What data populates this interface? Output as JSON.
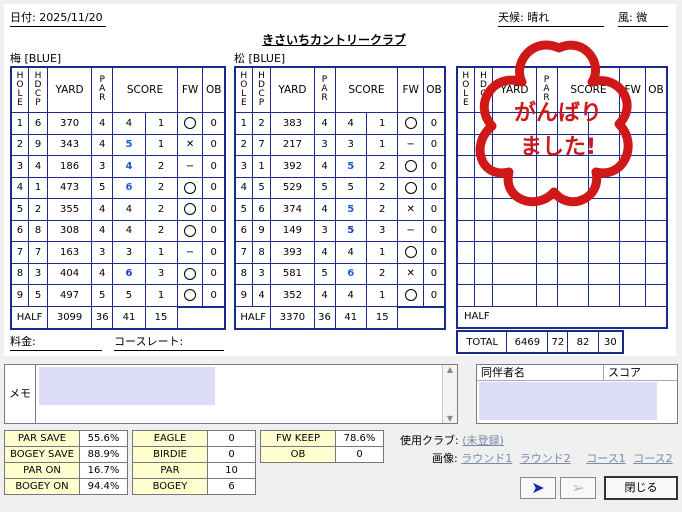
{
  "header": {
    "date_label": "日付: 2025/11/20",
    "title": "きさいちカントリークラブ",
    "weather_label": "天候: 晴れ",
    "wind_label": "風: 微"
  },
  "front": {
    "heading": "梅 [BLUE]"
  },
  "back": {
    "heading": "松 [BLUE]"
  },
  "columns": {
    "hole": "HOLE",
    "hdcp": "HDCP",
    "yard": "YARD",
    "par": "PAR",
    "score": "SCORE",
    "fw": "FW",
    "ob": "OB"
  },
  "front_rows": [
    {
      "hole": "1",
      "hdcp": "6",
      "yard": "370",
      "par": "4",
      "s": "4",
      "p": "1",
      "fw": "o",
      "ob": "0"
    },
    {
      "hole": "2",
      "hdcp": "9",
      "yard": "343",
      "par": "4",
      "s": "5",
      "p": "1",
      "fw": "x",
      "ob": "0"
    },
    {
      "hole": "3",
      "hdcp": "4",
      "yard": "186",
      "par": "3",
      "s": "4",
      "p": "2",
      "fw": "-",
      "ob": "0"
    },
    {
      "hole": "4",
      "hdcp": "1",
      "yard": "473",
      "par": "5",
      "s": "6",
      "p": "2",
      "fw": "o",
      "ob": "0"
    },
    {
      "hole": "5",
      "hdcp": "2",
      "yard": "355",
      "par": "4",
      "s": "4",
      "p": "2",
      "fw": "o",
      "ob": "0"
    },
    {
      "hole": "6",
      "hdcp": "8",
      "yard": "308",
      "par": "4",
      "s": "4",
      "p": "2",
      "fw": "o",
      "ob": "0"
    },
    {
      "hole": "7",
      "hdcp": "7",
      "yard": "163",
      "par": "3",
      "s": "3",
      "p": "1",
      "fw": "-",
      "ob": "0"
    },
    {
      "hole": "8",
      "hdcp": "3",
      "yard": "404",
      "par": "4",
      "s": "6",
      "p": "3",
      "fw": "o",
      "ob": "0"
    },
    {
      "hole": "9",
      "hdcp": "5",
      "yard": "497",
      "par": "5",
      "s": "5",
      "p": "1",
      "fw": "o",
      "ob": "0"
    }
  ],
  "back_rows": [
    {
      "hole": "1",
      "hdcp": "2",
      "yard": "383",
      "par": "4",
      "s": "4",
      "p": "1",
      "fw": "o",
      "ob": "0"
    },
    {
      "hole": "2",
      "hdcp": "7",
      "yard": "217",
      "par": "3",
      "s": "3",
      "p": "1",
      "fw": "-",
      "ob": "0"
    },
    {
      "hole": "3",
      "hdcp": "1",
      "yard": "392",
      "par": "4",
      "s": "5",
      "p": "2",
      "fw": "o",
      "ob": "0"
    },
    {
      "hole": "4",
      "hdcp": "5",
      "yard": "529",
      "par": "5",
      "s": "5",
      "p": "2",
      "fw": "o",
      "ob": "0"
    },
    {
      "hole": "5",
      "hdcp": "6",
      "yard": "374",
      "par": "4",
      "s": "5",
      "p": "2",
      "fw": "x",
      "ob": "0"
    },
    {
      "hole": "6",
      "hdcp": "9",
      "yard": "149",
      "par": "3",
      "s": "5",
      "p": "3",
      "fw": "-",
      "ob": "0"
    },
    {
      "hole": "7",
      "hdcp": "8",
      "yard": "393",
      "par": "4",
      "s": "4",
      "p": "1",
      "fw": "o",
      "ob": "0"
    },
    {
      "hole": "8",
      "hdcp": "3",
      "yard": "581",
      "par": "5",
      "s": "6",
      "p": "2",
      "fw": "x",
      "ob": "0"
    },
    {
      "hole": "9",
      "hdcp": "4",
      "yard": "352",
      "par": "4",
      "s": "4",
      "p": "1",
      "fw": "o",
      "ob": "0"
    }
  ],
  "front_half": {
    "label": "HALF",
    "yard": "3099",
    "par": "36",
    "score": "41",
    "putts": "15"
  },
  "back_half": {
    "label": "HALF",
    "yard": "3370",
    "par": "36",
    "score": "41",
    "putts": "15"
  },
  "third_half": {
    "label": "HALF"
  },
  "total": {
    "label": "TOTAL",
    "yard": "6469",
    "par": "72",
    "score": "82",
    "putts": "30"
  },
  "stamp": {
    "line1": "がんばり",
    "line2": "ました!"
  },
  "fee_label": "料金:",
  "course_rate_label": "コースレート:",
  "memo_label": "メモ",
  "partner": {
    "name_col": "同伴者名",
    "score_col": "スコア"
  },
  "stats1": [
    {
      "label": "PAR SAVE",
      "value": "55.6%"
    },
    {
      "label": "BOGEY SAVE",
      "value": "88.9%"
    },
    {
      "label": "PAR ON",
      "value": "16.7%"
    },
    {
      "label": "BOGEY ON",
      "value": "94.4%"
    }
  ],
  "stats2": [
    {
      "label": "EAGLE",
      "value": "0"
    },
    {
      "label": "BIRDIE",
      "value": "0"
    },
    {
      "label": "PAR",
      "value": "10"
    },
    {
      "label": "BOGEY",
      "value": "6"
    }
  ],
  "stats3": [
    {
      "label": "FW KEEP",
      "value": "78.6%"
    },
    {
      "label": "OB",
      "value": "0"
    }
  ],
  "club_label": "使用クラブ:",
  "club_link": "(未登録)",
  "image_label": "画像:",
  "image_links": [
    "ラウンド1",
    "ラウンド2",
    "コース1",
    "コース2"
  ],
  "buttons": {
    "close": "閉じる"
  },
  "colors": {
    "grid": "#1a2a8a",
    "stamp": "#d01818",
    "memo_bg": "#dcdcf8"
  }
}
